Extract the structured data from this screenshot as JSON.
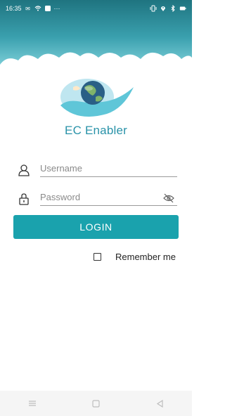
{
  "status_bar": {
    "time": "16:35",
    "dots": "···"
  },
  "app": {
    "title": "EC Enabler"
  },
  "form": {
    "username_placeholder": "Username",
    "password_placeholder": "Password",
    "login_label": "LOGIN",
    "remember_label": "Remember me",
    "remember_checked": false
  },
  "colors": {
    "accent": "#1aa2ad",
    "title": "#2a93a9",
    "header_dark": "#1f7480"
  },
  "icons": {
    "user": "user-icon",
    "lock": "lock-icon",
    "eye_off": "eye-off-icon",
    "nav_menu": "menu-icon",
    "nav_home": "home-square-icon",
    "nav_back": "back-triangle-icon"
  }
}
